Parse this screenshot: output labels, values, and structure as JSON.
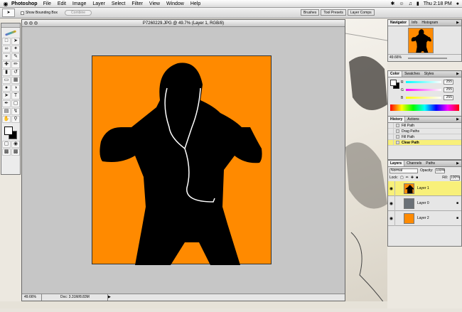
{
  "menubar": {
    "app": "Photoshop",
    "items": [
      "File",
      "Edit",
      "Image",
      "Layer",
      "Select",
      "Filter",
      "View",
      "Window",
      "Help"
    ],
    "clock": "Thu 2:18 PM"
  },
  "options": {
    "show_bounding_box": "Show Bounding Box",
    "combine": "Combine"
  },
  "palette_well": [
    "Brushes",
    "Tool Presets",
    "Layer Comps"
  ],
  "document": {
    "title": "P7260229.JPG @ 49.7% (Layer 1, RGB/8)",
    "zoom": "49.66%",
    "doc_info": "Doc: 3.31M/8.83M"
  },
  "navigator": {
    "tabs": [
      "Navigator",
      "Info",
      "Histogram"
    ],
    "zoom": "49.66%"
  },
  "color": {
    "tabs": [
      "Color",
      "Swatches",
      "Styles"
    ],
    "channels": [
      {
        "label": "R",
        "value": "255"
      },
      {
        "label": "G",
        "value": "255"
      },
      {
        "label": "B",
        "value": "255"
      }
    ]
  },
  "history": {
    "tabs": [
      "History",
      "Actions"
    ],
    "items": [
      {
        "label": "Fill Path",
        "selected": false
      },
      {
        "label": "Drag Paths",
        "selected": false
      },
      {
        "label": "Fill Path",
        "selected": false
      },
      {
        "label": "Clear Path",
        "selected": true
      }
    ]
  },
  "layers": {
    "tabs": [
      "Layers",
      "Channels",
      "Paths"
    ],
    "blend_mode": "Normal",
    "opacity_label": "Opacity:",
    "opacity": "100%",
    "lock_label": "Lock:",
    "fill_label": "Fill:",
    "fill": "100%",
    "items": [
      {
        "name": "Layer 1",
        "selected": true
      },
      {
        "name": "Layer 0",
        "selected": false
      },
      {
        "name": "Layer 2",
        "selected": false
      }
    ]
  },
  "colors": {
    "canvas_orange": "#ff8a00",
    "selection_yellow": "#f8f07a"
  }
}
